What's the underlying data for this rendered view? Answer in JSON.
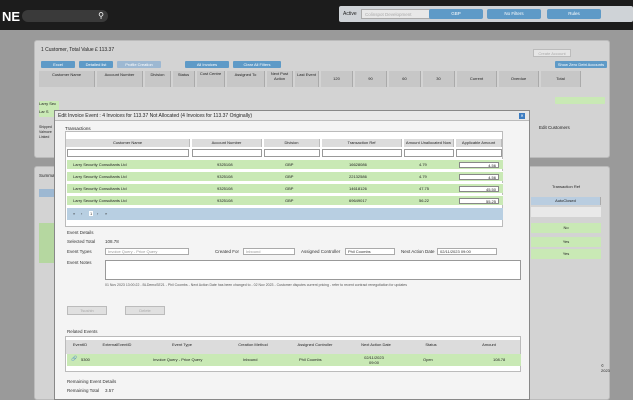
{
  "topbar": {
    "logo": "NE",
    "active_label": "Active",
    "active_value": "Colinspot Development",
    "buttons": [
      "GBP",
      "No Filters",
      "Rules"
    ]
  },
  "background": {
    "summary": "1 Customer, Total Value £ 113.37",
    "top_right_btn": "Create Account",
    "btn_row": [
      "Excel",
      "Detailed list",
      "Profile Creation",
      "All Invoices",
      "Clear All Filters"
    ],
    "right_btn": "Show Zero Debt Accounts",
    "cols": [
      "Customer Name",
      "Account Number",
      "Division",
      "Status",
      "Cost Centre",
      "Assigned To",
      "Next Post Action",
      "Last Event",
      "120",
      "90",
      "60",
      "30",
      "Current",
      "Overdue",
      "Total"
    ],
    "edit_btn": "Edit Customers",
    "left_tags": [
      "Larry Sec",
      "Lar S",
      "Shipped",
      "Valmore",
      "Linked"
    ],
    "panel2_title": "Summary",
    "panel2_cols": [
      "Transaction Ref",
      "AutoClosed"
    ],
    "panel2_rows": [
      "No",
      "Yes",
      "Yes"
    ],
    "footer": "© 2023"
  },
  "modal": {
    "title": "Edit Invoice Event : 4 Invoices for 113.37 Not Allocated (4 Invoices for 113.37 Originally)",
    "close_icon": "close-icon",
    "transactions_label": "Transactions",
    "columns": [
      "Customer Name",
      "Account Number",
      "Division",
      "Transaction Ref",
      "Amount Unallocated Now",
      "Applicable Amount"
    ],
    "rows": [
      {
        "name": "Larry Security Consultants Ltd",
        "account": "9325108",
        "division": "GBP",
        "ref": "16628086",
        "unalloc": "4.79",
        "amount": "4.56"
      },
      {
        "name": "Larry Security Consultants Ltd",
        "account": "9325108",
        "division": "GBP",
        "ref": "22132586",
        "unalloc": "4.79",
        "amount": "4.56"
      },
      {
        "name": "Larry Security Consultants Ltd",
        "account": "9325108",
        "division": "GBP",
        "ref": "14618126",
        "unalloc": "47.75",
        "amount": "45.50"
      },
      {
        "name": "Larry Security Consultants Ltd",
        "account": "9325108",
        "division": "GBP",
        "ref": "69649017",
        "unalloc": "56.22",
        "amount": "55.25"
      }
    ],
    "pager": {
      "page": "1"
    },
    "event_details_label": "Event Details",
    "selected_total_label": "Selected Total",
    "selected_total": "108.78",
    "event_types_label": "Event Types",
    "event_type": "Invoice Query - Price Query",
    "created_for_label": "Created For",
    "created_for": "Inbound",
    "assigned_controller_label": "Assigned Controller",
    "assigned_controller": "Phil Coombs",
    "next_action_label": "Next Action Date",
    "next_action": "02/11/2023 09:00",
    "event_notes_label": "Event Notes",
    "history_note": "01 Nov 2023 13:00:22 - BLDemoSE21 - Phil Coombs - Next Action Date has been changed to - 02 Nov 2023 - Customer disputes current pricing - refer to recent contract renegotiation for updates",
    "btn_a": "Tsushin",
    "btn_b": "Delete",
    "related_label": "Related Events",
    "rel_cols": [
      "EventID",
      "ExternalEventID",
      "Event Type",
      "Creation Method",
      "Assigned Controller",
      "Next Action Date",
      "Status",
      "Amount"
    ],
    "rel_row": {
      "id": "5300",
      "ext": "",
      "type": "Invoice Query - Price Query",
      "method": "Inbound",
      "ctrl": "Phil Coombs",
      "date": "02/11/2023 09:00",
      "status": "Open",
      "amount": "108.78"
    },
    "remaining_label": "Remaining Event Details",
    "remaining_total_label": "Remaining Total",
    "remaining_total": "3.57"
  }
}
